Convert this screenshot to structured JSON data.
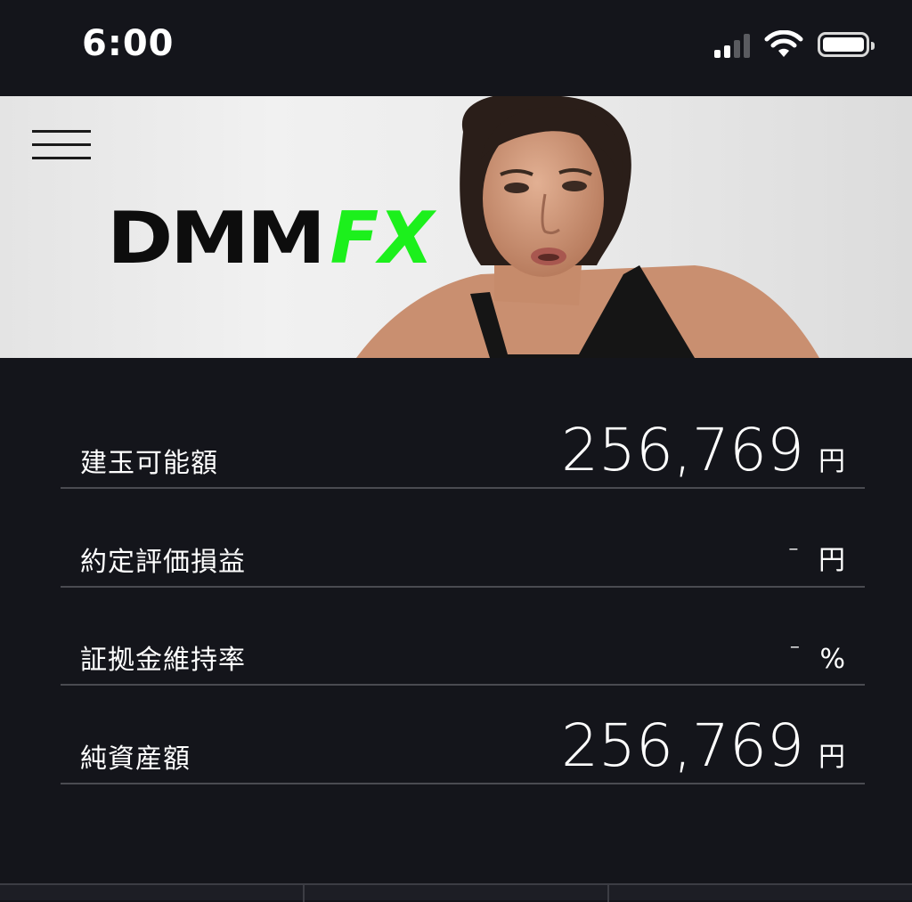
{
  "status_bar": {
    "time": "6:00"
  },
  "banner": {
    "logo_main": "DMM",
    "logo_accent": "FX",
    "accent_color": "#1cf01c"
  },
  "account": {
    "rows": [
      {
        "label": "建玉可能額",
        "value": "256,769",
        "unit": "円"
      },
      {
        "label": "約定評価損益",
        "value": "-",
        "unit": "円"
      },
      {
        "label": "証拠金維持率",
        "value": "-",
        "unit": "%"
      },
      {
        "label": "純資産額",
        "value": "256,769",
        "unit": "円"
      }
    ]
  }
}
